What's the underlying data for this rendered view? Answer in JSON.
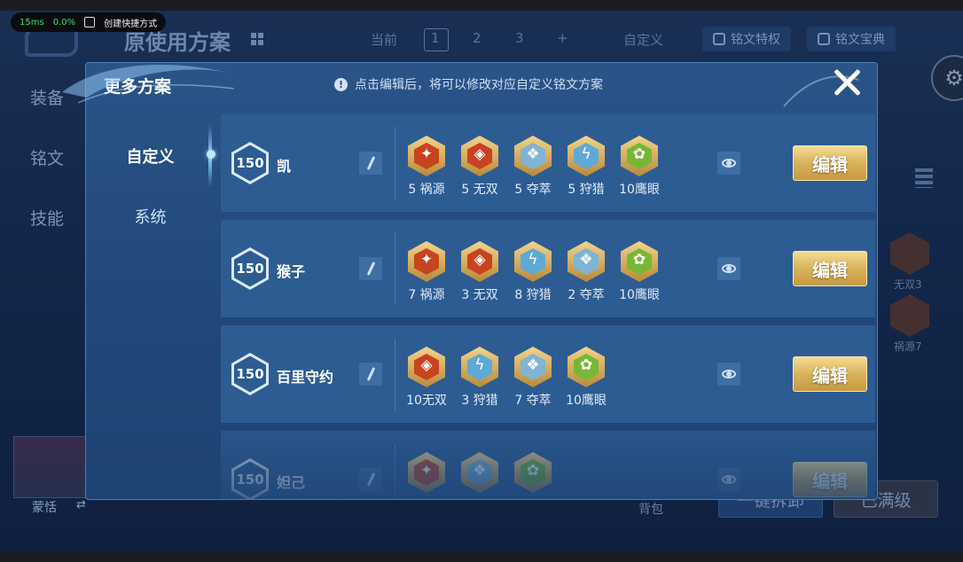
{
  "perf": {
    "latency": "15ms",
    "cpu": "0.0%",
    "shortcut": "创建快捷方式"
  },
  "background": {
    "title": "原使用方案",
    "side": [
      "装备",
      "铭文",
      "技能"
    ],
    "tabs": {
      "current": "当前",
      "pages": [
        "1",
        "2",
        "3"
      ],
      "add": "+",
      "custom": "自定义"
    },
    "buttons": [
      "铭文特权",
      "铭文宝典"
    ],
    "rune_labels": [
      "无双3",
      "祸源7"
    ],
    "hero_name": "蒙恬",
    "swap": "⇄",
    "bag": "背包",
    "sell": "一键拆卸",
    "maxed": "已满级"
  },
  "modal": {
    "title": "更多方案",
    "hint": "点击编辑后，将可以修改对应自定义铭文方案",
    "tabs": [
      {
        "label": "自定义",
        "active": true
      },
      {
        "label": "系统",
        "active": false
      }
    ],
    "edit_label": "编辑",
    "rows": [
      {
        "level": "150",
        "name": "凯",
        "runes": [
          {
            "label": "5 祸源",
            "color": "#c8431f",
            "glyph": "✦"
          },
          {
            "label": "5 无双",
            "color": "#c8431f",
            "glyph": "◈"
          },
          {
            "label": "5 夺萃",
            "color": "#7fb4d4",
            "glyph": "❖"
          },
          {
            "label": "5 狩猎",
            "color": "#5fa9d6",
            "glyph": "ϟ"
          },
          {
            "label": "10鹰眼",
            "color": "#76b835",
            "glyph": "✿"
          }
        ]
      },
      {
        "level": "150",
        "name": "猴子",
        "runes": [
          {
            "label": "7 祸源",
            "color": "#c8431f",
            "glyph": "✦"
          },
          {
            "label": "3 无双",
            "color": "#c8431f",
            "glyph": "◈"
          },
          {
            "label": "8 狩猎",
            "color": "#5fa9d6",
            "glyph": "ϟ"
          },
          {
            "label": "2 夺萃",
            "color": "#7fb4d4",
            "glyph": "❖"
          },
          {
            "label": "10鹰眼",
            "color": "#76b835",
            "glyph": "✿"
          }
        ]
      },
      {
        "level": "150",
        "name": "百里守约",
        "runes": [
          {
            "label": "10无双",
            "color": "#c8431f",
            "glyph": "◈"
          },
          {
            "label": "3 狩猎",
            "color": "#5fa9d6",
            "glyph": "ϟ"
          },
          {
            "label": "7 夺萃",
            "color": "#7fb4d4",
            "glyph": "❖"
          },
          {
            "label": "10鹰眼",
            "color": "#76b835",
            "glyph": "✿"
          }
        ]
      },
      {
        "level": "150",
        "name": "妲己",
        "runes": [
          {
            "label": "",
            "color": "#c8431f",
            "glyph": "✦"
          },
          {
            "label": "",
            "color": "#7fb4d4",
            "glyph": "❖"
          },
          {
            "label": "",
            "color": "#76b835",
            "glyph": "✿"
          }
        ]
      }
    ]
  }
}
